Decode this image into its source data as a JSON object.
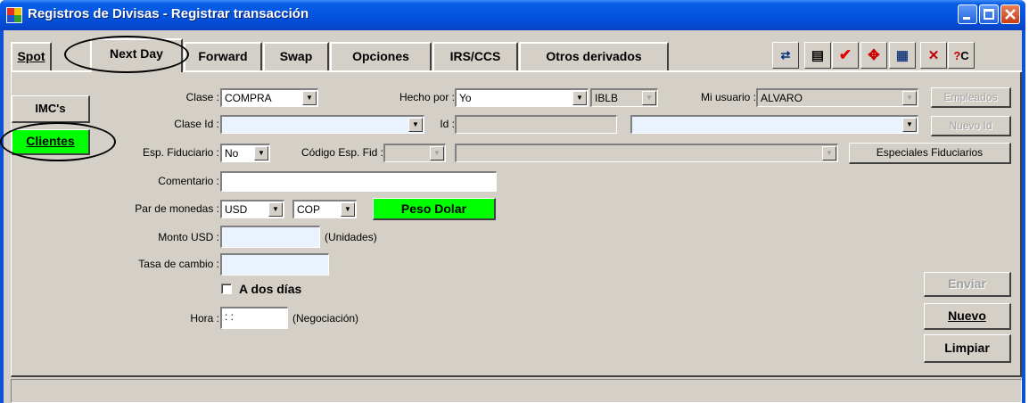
{
  "window": {
    "title": "Registros de Divisas - Registrar transacción"
  },
  "tabs": [
    {
      "label": "Spot"
    },
    {
      "label": "Next Day"
    },
    {
      "label": "Forward"
    },
    {
      "label": "Swap"
    },
    {
      "label": "Opciones"
    },
    {
      "label": "IRS/CCS"
    },
    {
      "label": "Otros derivados"
    }
  ],
  "toolbar_icons": [
    "export-icon",
    "document-icon",
    "check-user-icon",
    "move-icon",
    "report-icon",
    "delete-doc-icon",
    "query-icon"
  ],
  "side_buttons": {
    "imcs": "IMC's",
    "clientes": "Clientes"
  },
  "form": {
    "clase_label": "Clase :",
    "clase_value": "COMPRA",
    "hecho_por_label": "Hecho por :",
    "hecho_por_value": "Yo",
    "iblb_value": "IBLB",
    "mi_usuario_label": "Mi usuario :",
    "mi_usuario_value": "ALVARO",
    "empleados_button": "Empleados",
    "clase_id_label": "Clase Id :",
    "clase_id_value": "",
    "id_label": "Id :",
    "id_value": "",
    "nuevo_id_button": "Nuevo Id",
    "esp_fiduciario_label": "Esp. Fiduciario :",
    "esp_fiduciario_value": "No",
    "codigo_esp_fid_label": "Código Esp. Fid :",
    "especiales_fiduciarios_button": "Especiales Fiduciarios",
    "comentario_label": "Comentario :",
    "comentario_value": "",
    "par_monedas_label": "Par de monedas :",
    "moneda1": "USD",
    "moneda2": "COP",
    "peso_dolar_button": "Peso Dolar",
    "monto_label": "Monto USD :",
    "monto_value": "",
    "unidades": "(Unidades)",
    "tasa_label": "Tasa de cambio :",
    "tasa_value": "",
    "a_dos_dias_label": "A dos días",
    "hora_label": "Hora :",
    "hora_value": " : :",
    "negociacion": "(Negociación)"
  },
  "actions": {
    "enviar": "Enviar",
    "nuevo": "Nuevo",
    "limpiar": "Limpiar"
  },
  "colors": {
    "title_bar": "#0a5ee6",
    "face": "#d4d0c8",
    "green_button": "#00ff00",
    "input_blue": "#eaf3fd"
  }
}
